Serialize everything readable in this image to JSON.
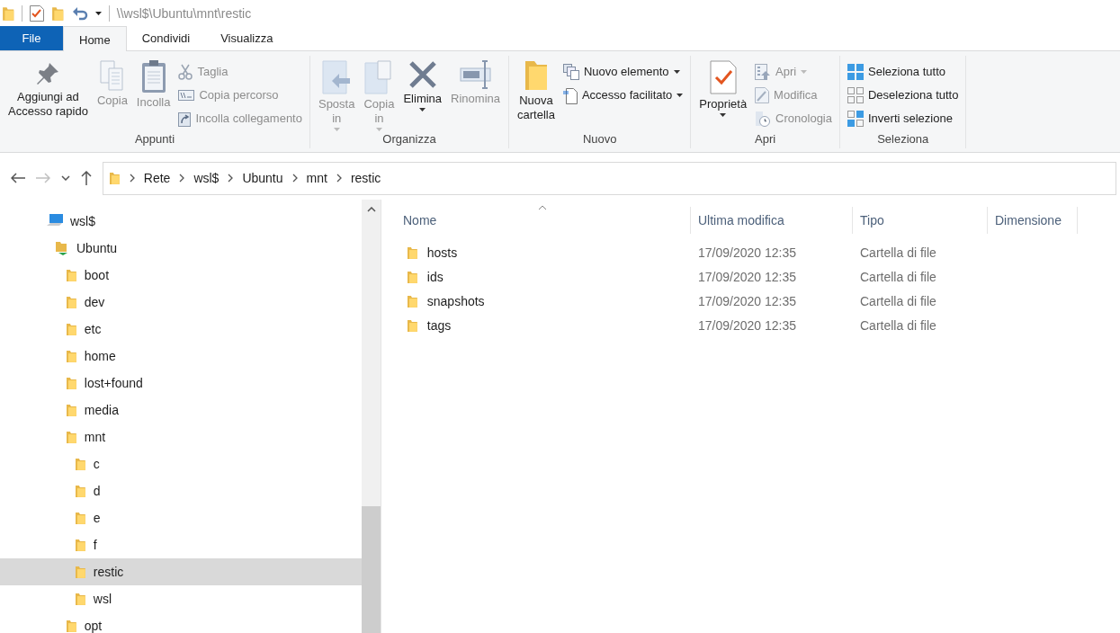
{
  "window": {
    "title": "\\\\wsl$\\Ubuntu\\mnt\\restic"
  },
  "tabs": [
    {
      "label": "File",
      "kind": "file"
    },
    {
      "label": "Home",
      "kind": "tab",
      "selected": true
    },
    {
      "label": "Condividi",
      "kind": "tab",
      "selected": false
    },
    {
      "label": "Visualizza",
      "kind": "tab",
      "selected": false
    }
  ],
  "ribbon": {
    "groups": [
      {
        "label": "Appunti",
        "items": [
          {
            "kind": "large",
            "label": "Aggiungi ad\nAccesso rapido",
            "disabled": false,
            "menu": false
          },
          {
            "kind": "large",
            "label": "Copia",
            "disabled": true,
            "menu": false
          },
          {
            "kind": "large",
            "label": "Incolla",
            "disabled": true,
            "menu": false
          },
          {
            "kind": "small",
            "label": "Taglia",
            "disabled": true,
            "menu": false
          },
          {
            "kind": "small",
            "label": "Copia percorso",
            "disabled": true,
            "menu": false
          },
          {
            "kind": "small",
            "label": "Incolla collegamento",
            "disabled": true,
            "menu": false
          }
        ]
      },
      {
        "label": "Organizza",
        "items": [
          {
            "kind": "large",
            "label": "Sposta\nin",
            "disabled": true,
            "menu": true
          },
          {
            "kind": "large",
            "label": "Copia\nin",
            "disabled": true,
            "menu": true
          },
          {
            "kind": "large",
            "label": "Elimina",
            "disabled": false,
            "menu": true
          },
          {
            "kind": "large",
            "label": "Rinomina",
            "disabled": true,
            "menu": false
          }
        ]
      },
      {
        "label": "Nuovo",
        "items": [
          {
            "kind": "large",
            "label": "Nuova\ncartella",
            "disabled": false,
            "menu": false
          },
          {
            "kind": "small",
            "label": "Nuovo elemento",
            "disabled": false,
            "menu": true
          },
          {
            "kind": "small",
            "label": "Accesso facilitato",
            "disabled": false,
            "menu": true
          }
        ]
      },
      {
        "label": "Apri",
        "items": [
          {
            "kind": "large",
            "label": "Proprietà",
            "disabled": false,
            "menu": true
          },
          {
            "kind": "small",
            "label": "Apri",
            "disabled": true,
            "menu": true
          },
          {
            "kind": "small",
            "label": "Modifica",
            "disabled": true,
            "menu": false
          },
          {
            "kind": "small",
            "label": "Cronologia",
            "disabled": true,
            "menu": false
          }
        ]
      },
      {
        "label": "Seleziona",
        "items": [
          {
            "kind": "small",
            "label": "Seleziona tutto",
            "disabled": false,
            "menu": false
          },
          {
            "kind": "small",
            "label": "Deseleziona tutto",
            "disabled": false,
            "menu": false
          },
          {
            "kind": "small",
            "label": "Inverti selezione",
            "disabled": false,
            "menu": false
          }
        ]
      }
    ]
  },
  "navigation": {
    "back_disabled": false,
    "forward_disabled": true
  },
  "address_bar": {
    "breadcrumbs": [
      "Rete",
      "wsl$",
      "Ubuntu",
      "mnt",
      "restic"
    ]
  },
  "sidebar": {
    "tree": [
      {
        "label": "wsl$",
        "kind": "computer",
        "selected": false,
        "children": [
          {
            "label": "Ubuntu",
            "kind": "drive",
            "selected": false,
            "children": [
              {
                "label": "boot",
                "kind": "folder",
                "selected": false
              },
              {
                "label": "dev",
                "kind": "folder",
                "selected": false
              },
              {
                "label": "etc",
                "kind": "folder",
                "selected": false
              },
              {
                "label": "home",
                "kind": "folder",
                "selected": false
              },
              {
                "label": "lost+found",
                "kind": "folder",
                "selected": false
              },
              {
                "label": "media",
                "kind": "folder",
                "selected": false
              },
              {
                "label": "mnt",
                "kind": "folder",
                "selected": false,
                "children": [
                  {
                    "label": "c",
                    "kind": "folder",
                    "selected": false
                  },
                  {
                    "label": "d",
                    "kind": "folder",
                    "selected": false
                  },
                  {
                    "label": "e",
                    "kind": "folder",
                    "selected": false
                  },
                  {
                    "label": "f",
                    "kind": "folder",
                    "selected": false
                  },
                  {
                    "label": "restic",
                    "kind": "folder",
                    "selected": true
                  },
                  {
                    "label": "wsl",
                    "kind": "folder",
                    "selected": false
                  }
                ]
              },
              {
                "label": "opt",
                "kind": "folder",
                "selected": false
              }
            ]
          }
        ]
      }
    ]
  },
  "table": {
    "columns": [
      "Nome",
      "Ultima modifica",
      "Tipo",
      "Dimensione"
    ],
    "rows": [
      {
        "name": "hosts",
        "modified": "17/09/2020 12:35",
        "type": "Cartella di file"
      },
      {
        "name": "ids",
        "modified": "17/09/2020 12:35",
        "type": "Cartella di file"
      },
      {
        "name": "snapshots",
        "modified": "17/09/2020 12:35",
        "type": "Cartella di file"
      },
      {
        "name": "tags",
        "modified": "17/09/2020 12:35",
        "type": "Cartella di file"
      }
    ]
  }
}
